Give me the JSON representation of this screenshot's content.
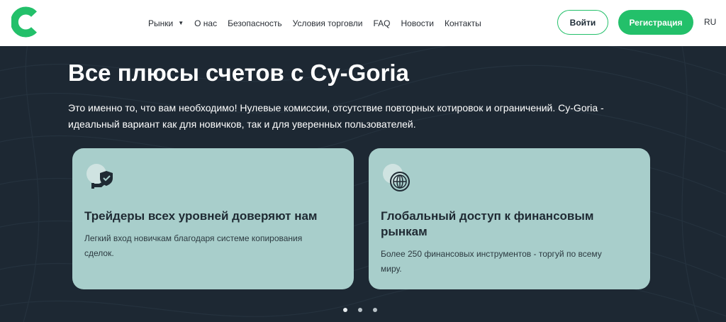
{
  "header": {
    "logo_letter": "C",
    "nav": [
      {
        "label": "Рынки",
        "has_dropdown": true
      },
      {
        "label": "О нас"
      },
      {
        "label": "Безопасность"
      },
      {
        "label": "Условия торговли"
      },
      {
        "label": "FAQ"
      },
      {
        "label": "Новости"
      },
      {
        "label": "Контакты"
      }
    ],
    "login_label": "Войти",
    "register_label": "Регистрация",
    "language": "RU"
  },
  "hero": {
    "title": "Все плюсы счетов с Cy-Goria",
    "subtitle": "Это именно то, что вам необходимо! Нулевые комиссии, отсутствие повторных котировок и ограничений. Cy-Goria - идеальный вариант как для новичков, так и для уверенных пользователей.",
    "cards": [
      {
        "icon": "shield-hand-icon",
        "title": "Трейдеры всех уровней доверяют нам",
        "text": "Легкий вход новичкам благодаря системе копирования сделок."
      },
      {
        "icon": "globe-icon",
        "title": "Глобальный доступ к финансовым рынкам",
        "text": "Более 250 финансовых инструментов - торгуй по всему миру."
      }
    ],
    "carousel": {
      "pages": 3,
      "active": 0
    }
  },
  "colors": {
    "accent": "#23c06a",
    "hero_bg": "#1d2833",
    "card_bg": "#a8cecb"
  }
}
